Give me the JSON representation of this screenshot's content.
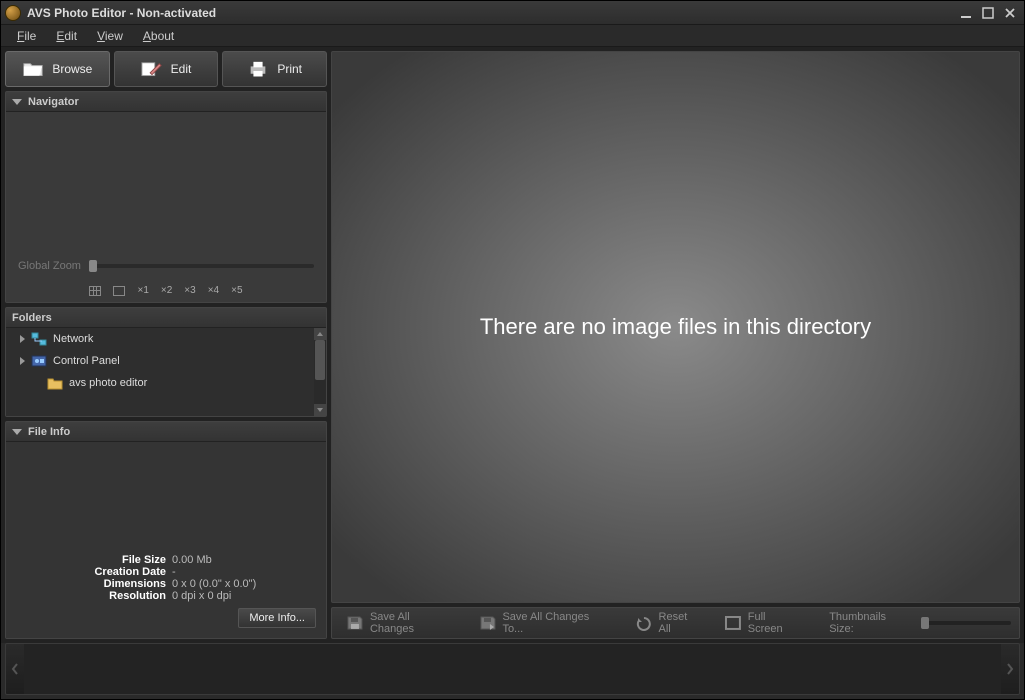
{
  "window": {
    "title": "AVS Photo Editor - Non-activated"
  },
  "menu": {
    "file": "File",
    "edit": "Edit",
    "view": "View",
    "about": "About"
  },
  "main_buttons": {
    "browse": "Browse",
    "edit": "Edit",
    "print": "Print"
  },
  "navigator": {
    "title": "Navigator",
    "global_zoom_label": "Global Zoom",
    "steps": {
      "x1": "×1",
      "x2": "×2",
      "x3": "×3",
      "x4": "×4",
      "x5": "×5"
    }
  },
  "folders": {
    "title": "Folders",
    "items": [
      {
        "label": "Network",
        "icon": "network",
        "expandable": true,
        "indent": false
      },
      {
        "label": "Control Panel",
        "icon": "cpanel",
        "expandable": true,
        "indent": false
      },
      {
        "label": "avs photo editor",
        "icon": "folder",
        "expandable": false,
        "indent": true
      }
    ]
  },
  "fileinfo": {
    "title": "File Info",
    "rows": {
      "size_label": "File Size",
      "size_val": "0.00 Mb",
      "date_label": "Creation Date",
      "date_val": "-",
      "dim_label": "Dimensions",
      "dim_val": "0 x 0 (0.0\" x 0.0\")",
      "res_label": "Resolution",
      "res_val": "0 dpi x 0 dpi"
    },
    "more_info": "More Info..."
  },
  "canvas": {
    "empty_message": "There are no image files in this directory"
  },
  "toolbar": {
    "save_all": "Save All Changes",
    "save_all_to": "Save All Changes To...",
    "reset_all": "Reset All",
    "full_screen": "Full Screen",
    "thumb_size_label": "Thumbnails Size:"
  }
}
